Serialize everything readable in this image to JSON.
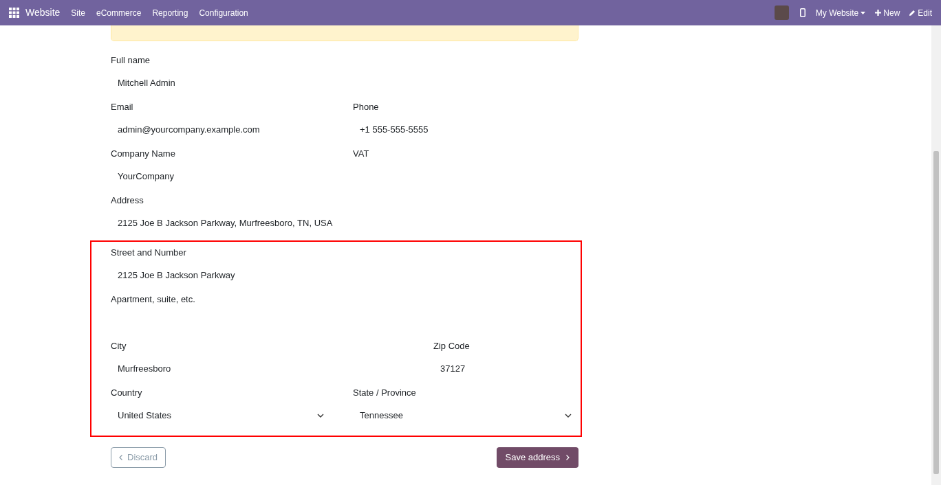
{
  "navbar": {
    "app_name": "Website",
    "menu": [
      "Site",
      "eCommerce",
      "Reporting",
      "Configuration"
    ],
    "website_selector": "My Website",
    "new_button": "New",
    "edit_button": "Edit"
  },
  "sections": [
    {
      "highlighted": false,
      "rows": [
        {
          "kind": "full",
          "fields": [
            {
              "label": "Full name",
              "value": "Mitchell Admin",
              "kind": "text"
            }
          ]
        },
        {
          "kind": "half",
          "fields": [
            {
              "label": "Email",
              "value": "admin@yourcompany.example.com",
              "kind": "text"
            },
            {
              "label": "Phone",
              "value": "+1 555-555-5555",
              "kind": "text"
            }
          ]
        },
        {
          "kind": "half",
          "fields": [
            {
              "label": "Company Name",
              "value": "YourCompany",
              "kind": "text"
            },
            {
              "label": "VAT",
              "kind": "text"
            }
          ]
        },
        {
          "kind": "full",
          "fields": [
            {
              "label": "Address",
              "value": "2125 Joe B Jackson Parkway, Murfreesboro, TN, USA",
              "kind": "text"
            }
          ]
        }
      ]
    },
    {
      "highlighted": true,
      "rows": [
        {
          "kind": "full",
          "fields": [
            {
              "label": "Street and Number",
              "value": "2125 Joe B Jackson Parkway",
              "kind": "text"
            }
          ]
        },
        {
          "kind": "full",
          "fields": [
            {
              "label": "Apartment, suite, etc.",
              "kind": "text"
            }
          ]
        },
        {
          "kind": "wide",
          "fields": [
            {
              "label": "City",
              "value": "Murfreesboro",
              "kind": "text"
            },
            {
              "label": "Zip Code",
              "value": "37127",
              "kind": "text"
            }
          ]
        },
        {
          "kind": "half",
          "fields": [
            {
              "label": "Country",
              "value": "United States",
              "kind": "select"
            },
            {
              "label": "State / Province",
              "value": "Tennessee",
              "kind": "select"
            }
          ]
        }
      ]
    }
  ],
  "discard_button": "Discard",
  "save_button": "Save address"
}
